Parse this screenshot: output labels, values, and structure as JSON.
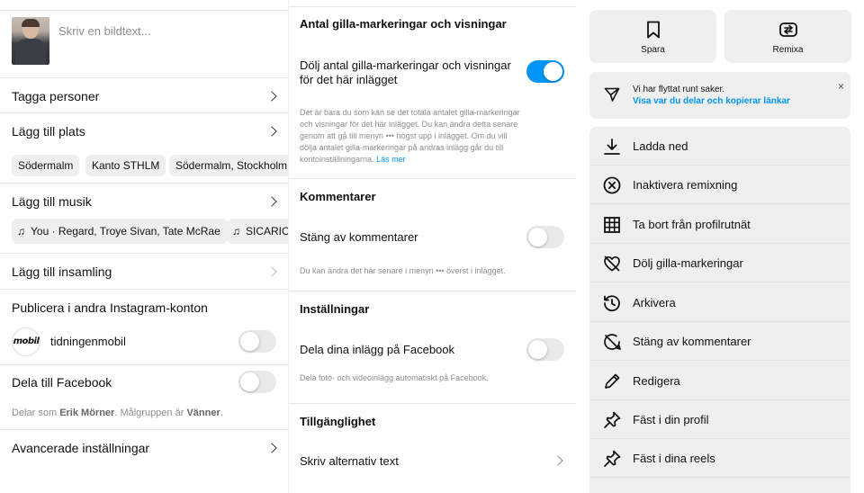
{
  "panel_left": {
    "caption_placeholder": "Skriv en bildtext...",
    "tag_people": "Tagga personer",
    "add_location": "Lägg till plats",
    "location_chips": [
      "Södermalm",
      "Kanto STHLM",
      "Södermalm, Stockholm"
    ],
    "add_music": "Lägg till musik",
    "music_chips": [
      "You · Regard, Troye Sivan, Tate McRae",
      "SICARIO"
    ],
    "add_to_collection": "Lägg till insamling",
    "publish_other_accounts": "Publicera i andra Instagram-konton",
    "account_logo": "mobil",
    "account_name": "tidningenmobil",
    "share_facebook": "Dela till Facebook",
    "shared_as_prefix": "Delar som",
    "shared_as_name": "Erik Mörner",
    "audience_prefix": ". Målgruppen är",
    "audience_value": "Vänner",
    "audience_suffix": ".",
    "advanced_settings": "Avancerade inställningar"
  },
  "panel_middle": {
    "likes_section_title": "Antal gilla-markeringar och visningar",
    "hide_likes_label_1": "Dölj antal gilla-markeringar och visningar",
    "hide_likes_label_2": "för det här inlägget",
    "hide_likes_toggle": "on",
    "likes_help": [
      "Det är bara du som kan se det totala antalet gilla-markeringar",
      "och visningar för det här inlägget. Du kan ändra detta senare",
      "genom att gå till menyn ••• högst upp i inlägget. Om du vill",
      "dölja antalet gilla-markeringar på andras inlägg går du till"
    ],
    "likes_help_last": "kontoinställningarna.",
    "read_more": "Läs mer",
    "comments_title": "Kommentarer",
    "turn_off_comments": "Stäng av kommentarer",
    "comments_help": "Du kan ändra det här senare i menyn ••• överst i inlägget.",
    "settings_title": "Inställningar",
    "share_facebook": "Dela dina inlägg på Facebook",
    "facebook_help": "Dela foto- och videoinlägg automatiskt på Facebook.",
    "accessibility_title": "Tillgänglighet",
    "alt_text": "Skriv alternativ text"
  },
  "panel_right": {
    "save": "Spara",
    "remix": "Remixa",
    "notice_line1": "Vi har flyttat runt saker.",
    "notice_line2": "Visa var du delar och kopierar länkar",
    "notice_close": "×",
    "menu": [
      {
        "label": "Ladda ned",
        "icon": "download-icon"
      },
      {
        "label": "Inaktivera remixning",
        "icon": "circle-x-icon"
      },
      {
        "label": "Ta bort från profilrutnät",
        "icon": "grid-icon"
      },
      {
        "label": "Dölj gilla-markeringar",
        "icon": "heart-off-icon"
      },
      {
        "label": "Arkivera",
        "icon": "archive-icon"
      },
      {
        "label": "Stäng av kommentarer",
        "icon": "comment-off-icon"
      },
      {
        "label": "Redigera",
        "icon": "pencil-icon"
      },
      {
        "label": "Fäst i din profil",
        "icon": "pin-icon"
      },
      {
        "label": "Fäst i dina reels",
        "icon": "pin-icon"
      }
    ]
  },
  "colors": {
    "accent": "#0095f6",
    "muted_text": "#8e8e8e",
    "tile_bg": "#efefef"
  }
}
